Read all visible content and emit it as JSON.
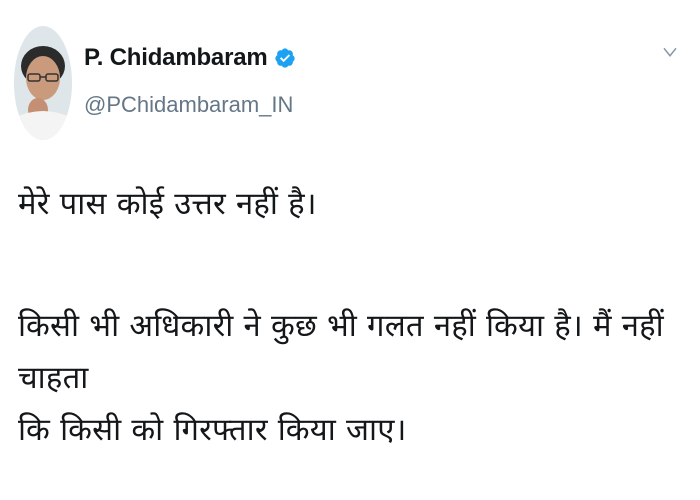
{
  "tweet": {
    "author": {
      "display_name": "P. Chidambaram",
      "handle": "@PChidambaram_IN",
      "verified_icon": "verified-badge-icon",
      "avatar_icon": "profile-photo"
    },
    "menu_icon": "chevron-down-icon",
    "text": {
      "paragraph_1": "मेरे पास कोई उत्तर नहीं है।",
      "paragraph_2_line_1": "किसी भी अधिकारी ने कुछ भी गलत नहीं किया है। मैं नहीं चाहता",
      "paragraph_2_line_2": "कि किसी को गिरफ्तार किया जाए।"
    }
  },
  "colors": {
    "text": "#14171a",
    "muted": "#657786",
    "verified": "#1da1f2"
  }
}
